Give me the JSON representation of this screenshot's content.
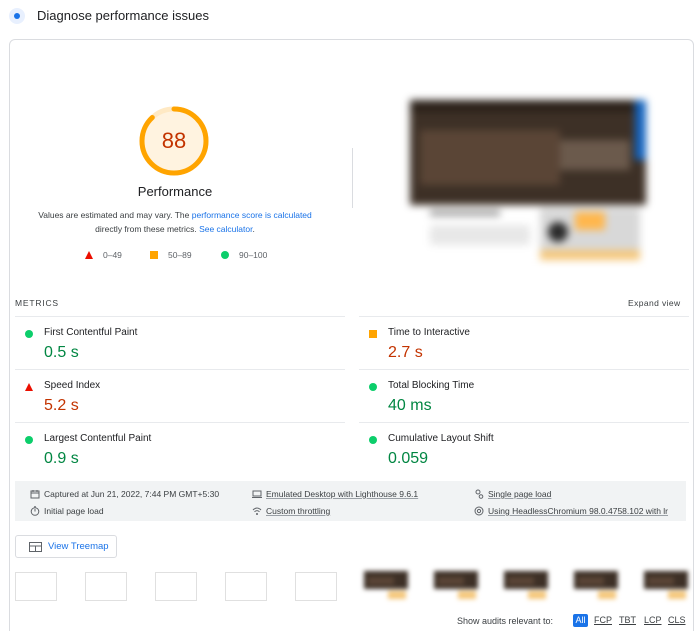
{
  "header": {
    "title": "Diagnose performance issues",
    "icon": "lighthouse-icon"
  },
  "performance": {
    "score": "88",
    "score_fraction": 0.88,
    "title": "Performance",
    "description_prefix": "Values are estimated and may vary. The ",
    "score_link": "performance score is calculated",
    "description_middle": " directly from these metrics. ",
    "calculator_link": "See calculator",
    "description_suffix": "."
  },
  "legend": [
    {
      "range": "0–49",
      "shape": "triangle",
      "color": "#eb0f00"
    },
    {
      "range": "50–89",
      "shape": "square",
      "color": "#ffa400"
    },
    {
      "range": "90–100",
      "shape": "circle",
      "color": "#0cce6b"
    }
  ],
  "metrics": {
    "label": "METRICS",
    "expand_label": "Expand view",
    "items": [
      {
        "title": "First Contentful Paint",
        "value": "0.5 s",
        "status": "good"
      },
      {
        "title": "Time to Interactive",
        "value": "2.7 s",
        "status": "average"
      },
      {
        "title": "Speed Index",
        "value": "5.2 s",
        "status": "poor"
      },
      {
        "title": "Total Blocking Time",
        "value": "40 ms",
        "status": "good"
      },
      {
        "title": "Largest Contentful Paint",
        "value": "0.9 s",
        "status": "good"
      },
      {
        "title": "Cumulative Layout Shift",
        "value": "0.059",
        "status": "good"
      }
    ]
  },
  "run_info": {
    "captured": "Captured at Jun 21, 2022, 7:44 PM GMT+5:30",
    "emulation": "Emulated Desktop with Lighthouse 9.6.1",
    "session": "Single page load",
    "load": "Initial page load",
    "throttling": "Custom throttling",
    "browser": "Using HeadlessChromium 98.0.4758.102 with lr"
  },
  "treemap": {
    "label": "View Treemap"
  },
  "audit_filter": {
    "label": "Show audits relevant to:",
    "options": [
      "All",
      "FCP",
      "TBT",
      "LCP",
      "CLS"
    ],
    "selected": "All"
  },
  "colors": {
    "good": "#018642",
    "average": "#c33300",
    "poor": "#c33300",
    "gauge": "#ffa400",
    "accent": "#1a73e8"
  }
}
